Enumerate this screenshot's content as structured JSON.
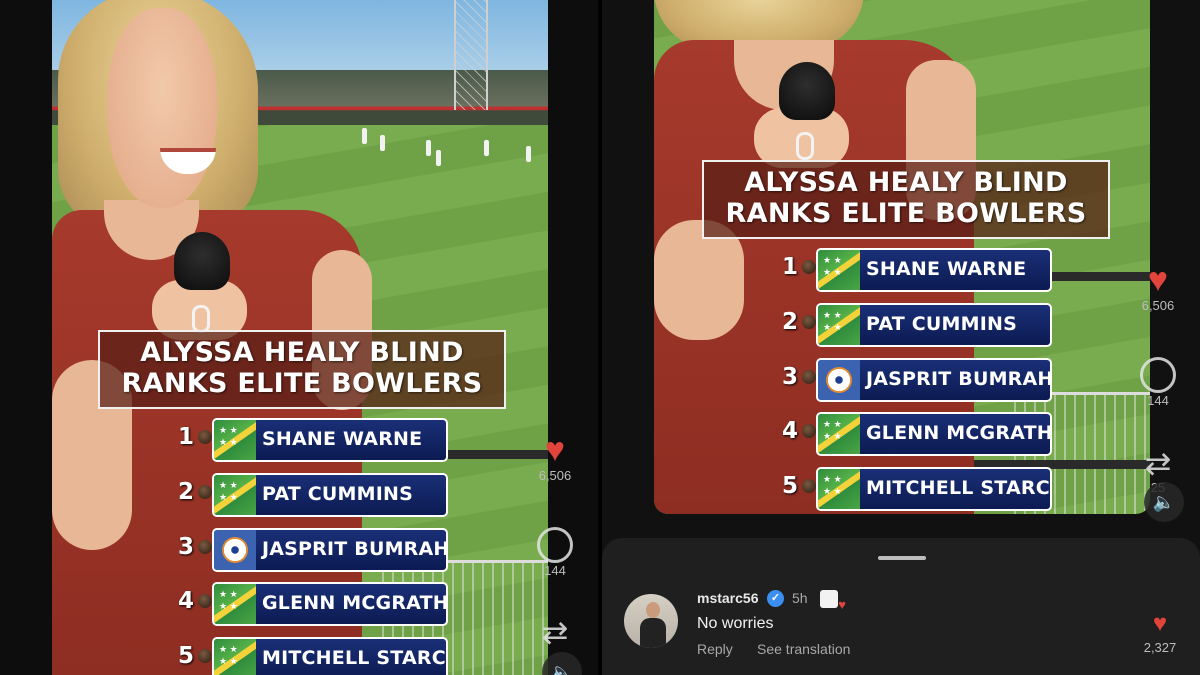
{
  "overlay": {
    "title_line1": "ALYSSA HEALY BLIND",
    "title_line2": "RANKS ELITE BOWLERS",
    "rankings": [
      {
        "rank": "1",
        "name": "SHANE WARNE",
        "flag": "australia-flag-icon"
      },
      {
        "rank": "2",
        "name": "PAT CUMMINS",
        "flag": "australia-flag-icon"
      },
      {
        "rank": "3",
        "name": "JASPRIT BUMRAH",
        "flag": "india-cricket-crest-icon"
      },
      {
        "rank": "4",
        "name": "GLENN MCGRATH",
        "flag": "australia-flag-icon"
      },
      {
        "rank": "5",
        "name": "MITCHELL STARC",
        "flag": "australia-flag-icon"
      }
    ]
  },
  "actions": {
    "likes": "6,506",
    "comments": "144",
    "reposts": "25"
  },
  "comment": {
    "username": "mstarc56",
    "time": "5h",
    "text": "No worries",
    "reply_label": "Reply",
    "translate_label": "See translation",
    "likes": "2,327"
  },
  "colors": {
    "heart": "#e0443a",
    "rank_bar": "#0c1b52",
    "title_bg": "#581e16",
    "verified": "#3a8ff0"
  }
}
